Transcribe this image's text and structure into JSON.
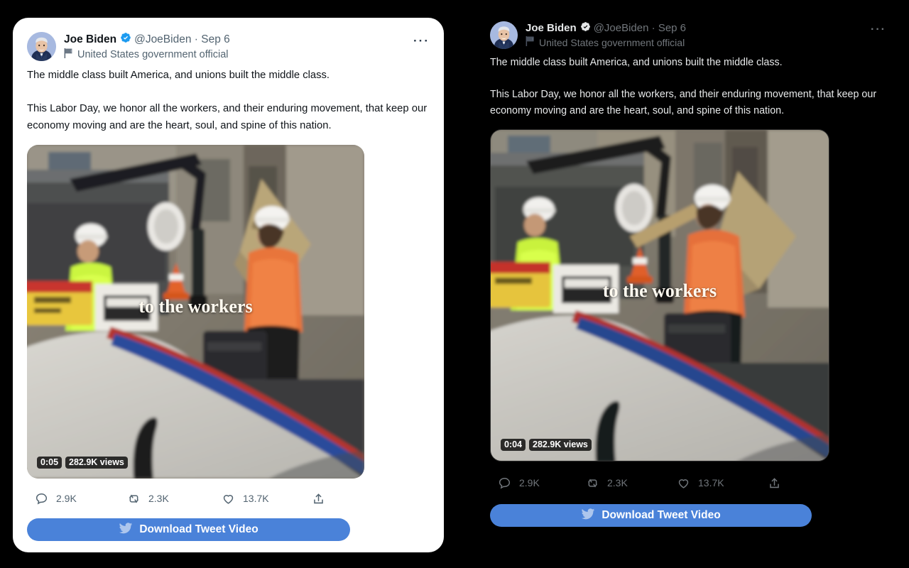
{
  "theme_colors": {
    "light_card_bg": "#ffffff",
    "dark_card_bg": "#000000",
    "page_bg": "#000000",
    "accent_blue": "#4a82d9",
    "verified_blue": "#1d9bf0",
    "light_primary_text": "#0f1419",
    "light_secondary_text": "#536471",
    "dark_primary_text": "#e7e9ea",
    "dark_secondary_text": "#71767b"
  },
  "tweet": {
    "author_name": "Joe Biden",
    "verified_badge_icon": "verified-check-icon",
    "handle": "@JoeBiden",
    "separator": "·",
    "date": "Sep 6",
    "more_menu_label": "···",
    "gov_flag_icon": "government-flag-icon",
    "gov_label": "United States government official",
    "body": "The middle class built America, and unions built the middle class.\n\nThis Labor Day, we honor all the workers, and their enduring movement, that keep our economy moving and are the heart, soul, and spine of this nation.",
    "avatar_alt": "avatar"
  },
  "video": {
    "caption_overlay": "to the workers",
    "views": "282.9K views"
  },
  "panels": {
    "light": {
      "timestamp": "0:05",
      "download_label": "Download Tweet Video"
    },
    "dark": {
      "timestamp": "0:04",
      "download_label": "Download Tweet Video"
    }
  },
  "actions": {
    "reply": {
      "icon": "reply-bubble-icon",
      "count": "2.9K"
    },
    "retweet": {
      "icon": "retweet-arrows-icon",
      "count": "2.3K"
    },
    "like": {
      "icon": "heart-icon",
      "count": "13.7K"
    },
    "share": {
      "icon": "share-upload-icon",
      "count": ""
    }
  }
}
